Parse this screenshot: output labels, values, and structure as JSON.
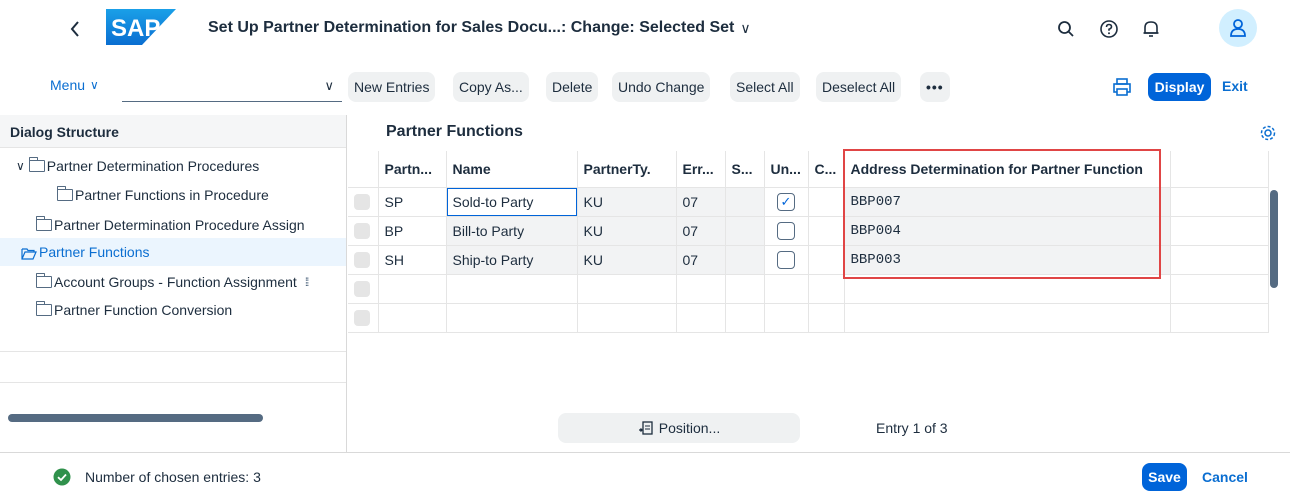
{
  "header": {
    "back_icon": "chevron-left-icon",
    "logo_text": "SAP",
    "title": "Set Up Partner Determination for Sales Docu...: Change: Selected Set",
    "title_chevron": "∨",
    "icons": [
      "search-icon",
      "help-icon",
      "bell-icon",
      "user-icon"
    ],
    "avatar_color": "#d1efff",
    "brand_color": "#0a6ed1"
  },
  "toolbar": {
    "menu_label": "Menu",
    "menu_chevron": "∨",
    "select_value": "",
    "select_chevron": "∨",
    "buttons": [
      "New Entries",
      "Copy As...",
      "Delete",
      "Undo Change",
      "Select All",
      "Deselect All"
    ],
    "more_label": "•••",
    "display_label": "Display",
    "exit_label": "Exit"
  },
  "dialog_structure": {
    "title": "Dialog Structure",
    "items": [
      {
        "label": "Partner Determination Procedures",
        "expanded": true
      },
      {
        "label": "Partner Functions in Procedure"
      },
      {
        "label": "Partner Determination Procedure Assign"
      },
      {
        "label": "Partner Functions",
        "selected": true
      },
      {
        "label": "Account Groups - Function Assignment"
      },
      {
        "label": "Partner Function Conversion"
      }
    ],
    "expand_glyph": "∨"
  },
  "partner_functions": {
    "title": "Partner Functions",
    "columns": [
      "Partn...",
      "Name",
      "PartnerTy.",
      "Err...",
      "S...",
      "Un...",
      "C...",
      "Address Determination for Partner Function"
    ],
    "rows": [
      {
        "partn": "SP",
        "name": "Sold-to Party",
        "partner_type": "KU",
        "err": "07",
        "s": "",
        "unique": true,
        "c": "",
        "address": "BBP007"
      },
      {
        "partn": "BP",
        "name": "Bill-to Party",
        "partner_type": "KU",
        "err": "07",
        "s": "",
        "unique": false,
        "c": "",
        "address": "BBP004"
      },
      {
        "partn": "SH",
        "name": "Ship-to Party",
        "partner_type": "KU",
        "err": "07",
        "s": "",
        "unique": false,
        "c": "",
        "address": "BBP003"
      }
    ],
    "checkmark": "✓",
    "position_label": "Position...",
    "entry_text": "Entry 1 of 3",
    "highlight_color": "#e04545"
  },
  "footer": {
    "status_text": "Number of chosen entries: 3",
    "status_color": "#30914c",
    "save_label": "Save",
    "cancel_label": "Cancel"
  }
}
